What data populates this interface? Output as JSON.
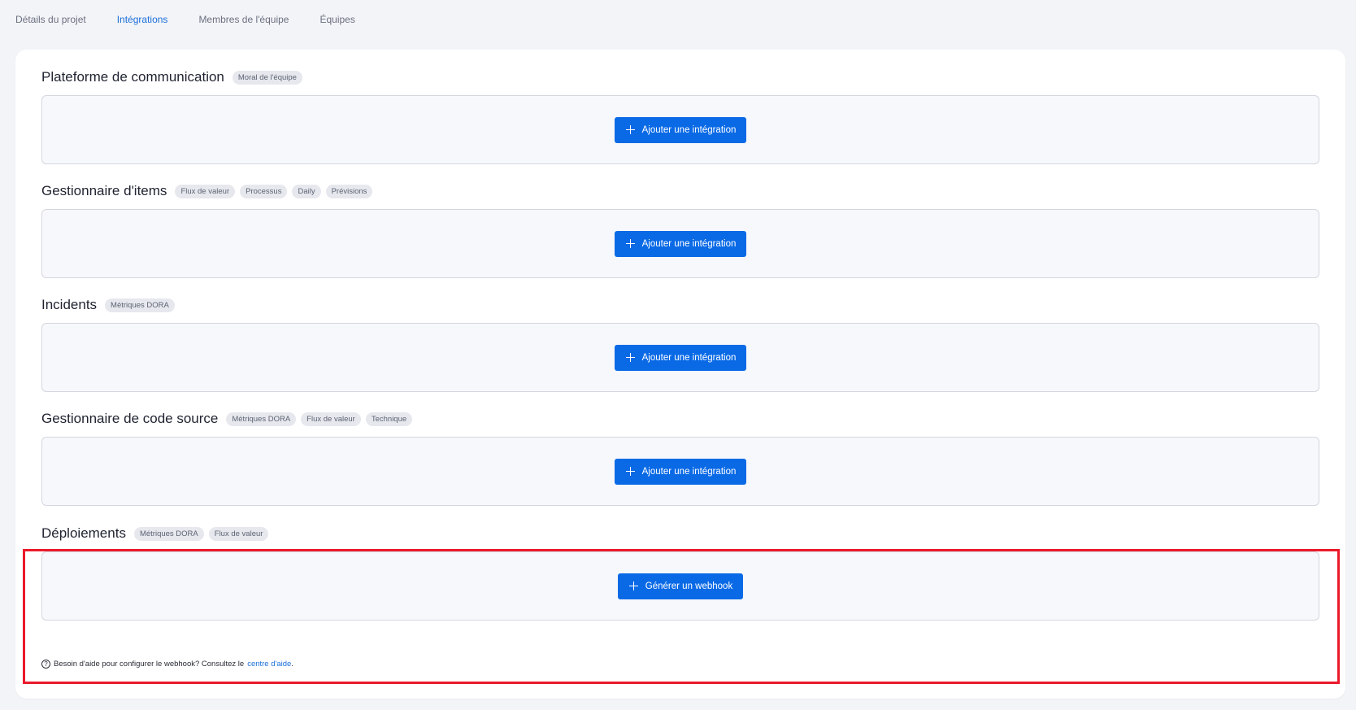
{
  "tabs": [
    {
      "label": "Détails du projet",
      "active": false
    },
    {
      "label": "Intégrations",
      "active": true
    },
    {
      "label": "Membres de l'équipe",
      "active": false
    },
    {
      "label": "Équipes",
      "active": false
    }
  ],
  "sections": [
    {
      "title": "Plateforme de communication",
      "tags": [
        "Moral de l'équipe"
      ],
      "button": "Ajouter une intégration"
    },
    {
      "title": "Gestionnaire d'items",
      "tags": [
        "Flux de valeur",
        "Processus",
        "Daily",
        "Prévisions"
      ],
      "button": "Ajouter une intégration"
    },
    {
      "title": "Incidents",
      "tags": [
        "Métriques DORA"
      ],
      "button": "Ajouter une intégration"
    },
    {
      "title": "Gestionnaire de code source",
      "tags": [
        "Métriques DORA",
        "Flux de valeur",
        "Technique"
      ],
      "button": "Ajouter une intégration"
    },
    {
      "title": "Déploiements",
      "tags": [
        "Métriques DORA",
        "Flux de valeur"
      ],
      "button": "Générer un webhook"
    }
  ],
  "help": {
    "icon": "?",
    "text": "Besoin d'aide pour configurer le webhook? Consultez le",
    "link": "centre d'aide",
    "suffix": "."
  },
  "colors": {
    "accent": "#0a6ae6",
    "highlight": "#ea1a2b"
  }
}
